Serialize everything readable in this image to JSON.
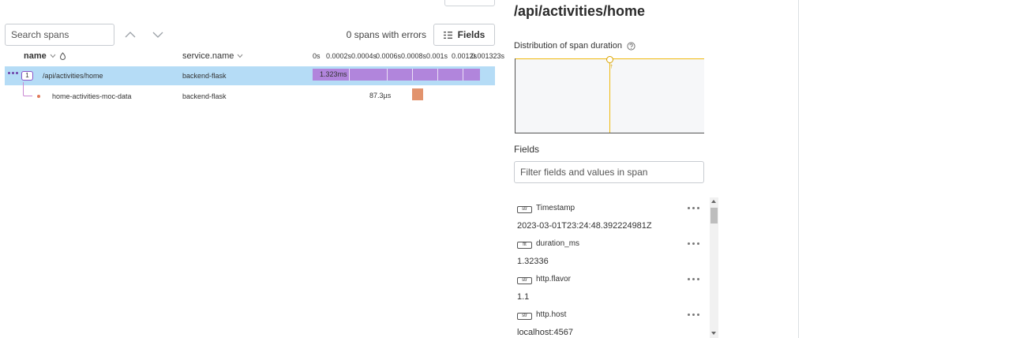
{
  "toolbar": {
    "search_placeholder": "Search spans",
    "errors_text": "0 spans with errors",
    "fields_button": "Fields"
  },
  "columns": {
    "name": "name",
    "service": "service.name",
    "ticks": [
      "0s",
      "0.0002s",
      "0.0004s",
      "0.0006s",
      "0.0008s",
      "0.001s",
      "0.0012s",
      "0.001323s"
    ]
  },
  "spans": [
    {
      "count": "1",
      "name": "/api/activities/home",
      "service": "backend-flask",
      "duration": "1.323ms"
    },
    {
      "name": "home-activities-moc-data",
      "service": "backend-flask",
      "duration": "87.3µs"
    }
  ],
  "detail": {
    "title": "/api/activities/home",
    "distribution_label": "Distribution of span duration",
    "fields_label": "Fields",
    "filter_placeholder": "Filter fields and values in span",
    "fields": [
      {
        "type": "str",
        "key": "Timestamp",
        "value": "2023-03-01T23:24:48.392224981Z"
      },
      {
        "type": "flt",
        "key": "duration_ms",
        "value": "1.32336"
      },
      {
        "type": "str",
        "key": "http.flavor",
        "value": "1.1"
      },
      {
        "type": "str",
        "key": "http.host",
        "value": "localhost:4567"
      }
    ]
  },
  "colors": {
    "selected_row": "#b5dcf6",
    "root_bar": "#b185dc",
    "child_bar": "#e2936d",
    "histogram_line": "#f0b90b"
  }
}
